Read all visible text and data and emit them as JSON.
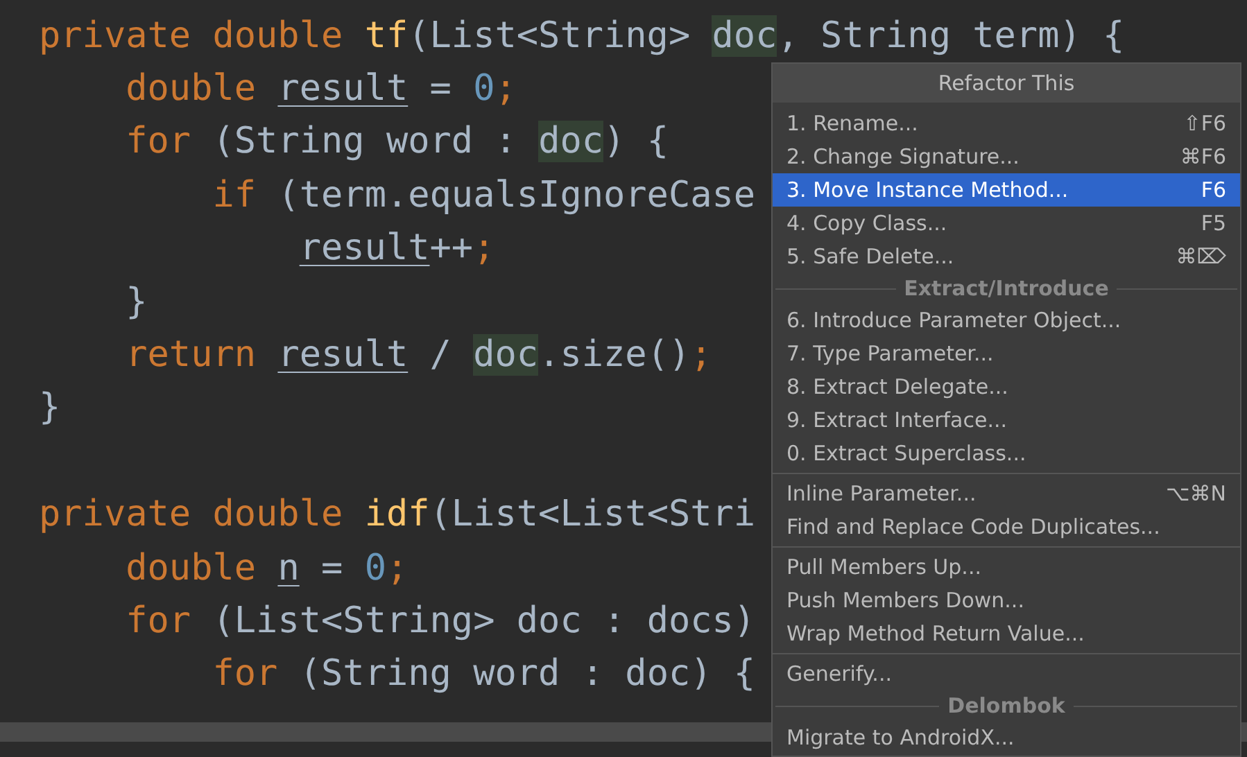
{
  "code_blocks": [
    {
      "lines": [
        {
          "tokens": [
            {
              "kind": "keyword",
              "text": "private double "
            },
            {
              "kind": "function",
              "text": "tf"
            },
            {
              "kind": "plain",
              "text": "(List<String> "
            },
            {
              "kind": "ref",
              "text": "doc"
            },
            {
              "kind": "plain",
              "text": ", String term) {"
            }
          ]
        },
        {
          "tokens": [
            {
              "kind": "keyword",
              "text": "    double "
            },
            {
              "kind": "var",
              "text": "result"
            },
            {
              "kind": "plain",
              "text": " = "
            },
            {
              "kind": "number",
              "text": "0"
            },
            {
              "kind": "keyword",
              "text": ";"
            }
          ]
        },
        {
          "tokens": [
            {
              "kind": "keyword",
              "text": "    for "
            },
            {
              "kind": "plain",
              "text": "(String word : "
            },
            {
              "kind": "ref",
              "text": "doc"
            },
            {
              "kind": "plain",
              "text": ") {"
            }
          ]
        },
        {
          "tokens": [
            {
              "kind": "keyword",
              "text": "        if "
            },
            {
              "kind": "plain",
              "text": "(term.equalsIgnoreCase"
            }
          ]
        },
        {
          "tokens": [
            {
              "kind": "var",
              "text": "            result"
            },
            {
              "kind": "plain",
              "text": "++"
            },
            {
              "kind": "keyword",
              "text": ";"
            }
          ]
        },
        {
          "tokens": [
            {
              "kind": "plain",
              "text": "    }"
            }
          ]
        },
        {
          "tokens": [
            {
              "kind": "keyword",
              "text": "    return "
            },
            {
              "kind": "var",
              "text": "result"
            },
            {
              "kind": "plain",
              "text": " / "
            },
            {
              "kind": "ref",
              "text": "doc"
            },
            {
              "kind": "plain",
              "text": ".size()"
            },
            {
              "kind": "keyword",
              "text": ";"
            }
          ]
        },
        {
          "tokens": [
            {
              "kind": "plain",
              "text": "}"
            }
          ]
        }
      ]
    },
    {
      "lines": [
        {
          "tokens": [
            {
              "kind": "keyword",
              "text": "private double "
            },
            {
              "kind": "function",
              "text": "idf"
            },
            {
              "kind": "plain",
              "text": "(List<List<Stri"
            }
          ]
        },
        {
          "tokens": [
            {
              "kind": "keyword",
              "text": "    double "
            },
            {
              "kind": "var",
              "text": "n"
            },
            {
              "kind": "plain",
              "text": " = "
            },
            {
              "kind": "number",
              "text": "0"
            },
            {
              "kind": "keyword",
              "text": ";"
            }
          ]
        },
        {
          "tokens": [
            {
              "kind": "keyword",
              "text": "    for "
            },
            {
              "kind": "plain",
              "text": "(List<String> doc : docs)"
            }
          ]
        },
        {
          "tokens": [
            {
              "kind": "keyword",
              "text": "        for "
            },
            {
              "kind": "plain",
              "text": "(String word : doc) {"
            }
          ]
        }
      ]
    }
  ],
  "menu": {
    "title": "Refactor This",
    "sections": [
      {
        "items": [
          {
            "label": "1. Rename...",
            "shortcut": "⇧F6",
            "selected": false
          },
          {
            "label": "2. Change Signature...",
            "shortcut": "⌘F6",
            "selected": false
          },
          {
            "label": "3. Move Instance Method...",
            "shortcut": "F6",
            "selected": true
          },
          {
            "label": "4. Copy Class...",
            "shortcut": "F5",
            "selected": false
          },
          {
            "label": "5. Safe Delete...",
            "shortcut": "⌘⌦",
            "selected": false
          }
        ]
      },
      {
        "heading": "Extract/Introduce",
        "items": [
          {
            "label": "6. Introduce Parameter Object...",
            "selected": false
          },
          {
            "label": "7. Type Parameter...",
            "selected": false
          },
          {
            "label": "8. Extract Delegate...",
            "selected": false
          },
          {
            "label": "9. Extract Interface...",
            "selected": false
          },
          {
            "label": "0. Extract Superclass...",
            "selected": false
          }
        ]
      },
      {
        "items": [
          {
            "label": "Inline Parameter...",
            "shortcut": "⌥⌘N",
            "selected": false
          },
          {
            "label": "Find and Replace Code Duplicates...",
            "selected": false
          }
        ]
      },
      {
        "items": [
          {
            "label": "Pull Members Up...",
            "selected": false
          },
          {
            "label": "Push Members Down...",
            "selected": false
          },
          {
            "label": "Wrap Method Return Value...",
            "selected": false
          }
        ]
      },
      {
        "items": [
          {
            "label": "Generify...",
            "selected": false
          }
        ]
      },
      {
        "heading": "Delombok",
        "items": [
          {
            "label": "Migrate to AndroidX...",
            "selected": false
          }
        ]
      }
    ]
  }
}
